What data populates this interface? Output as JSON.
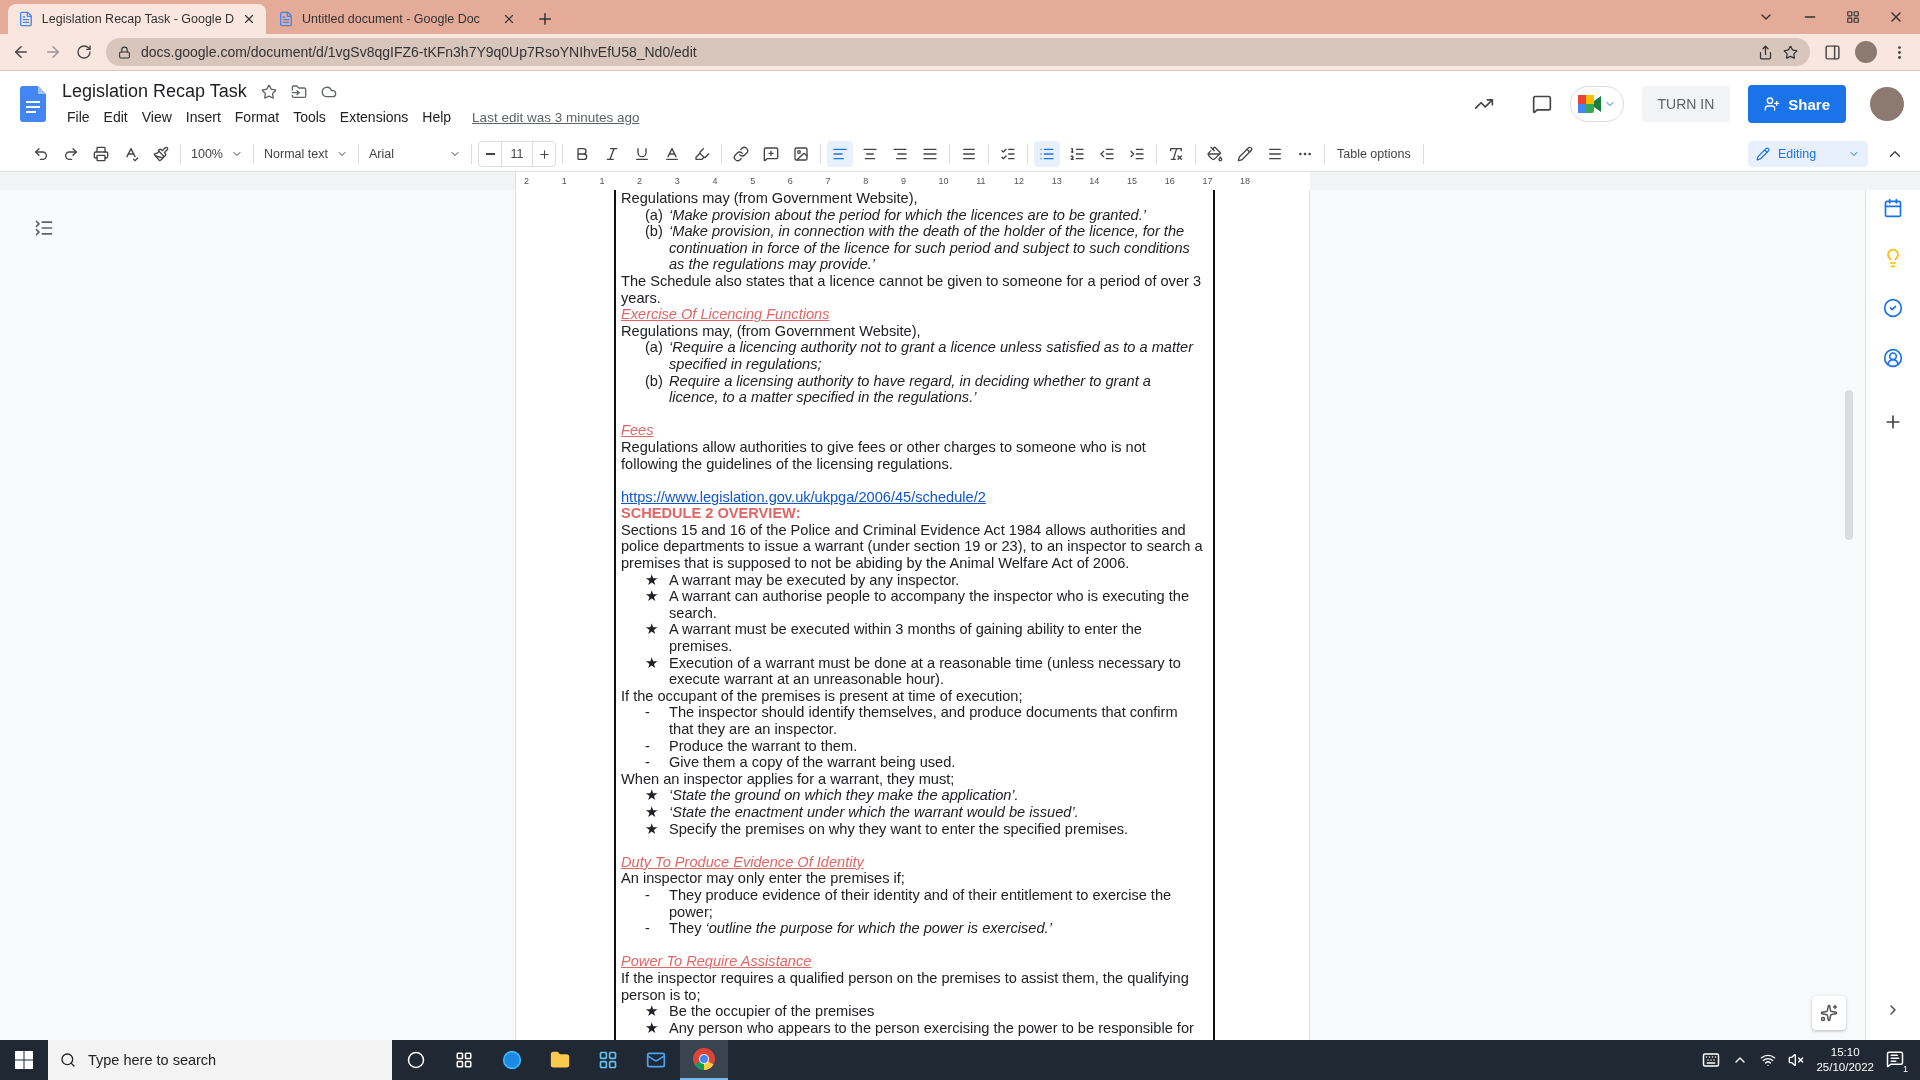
{
  "browser": {
    "tabs": [
      {
        "title": "Legislation Recap Task - Google D",
        "selected": true
      },
      {
        "title": "Untitled document - Google Doc",
        "selected": false
      }
    ],
    "url": "docs.google.com/document/d/1vgSv8qgIFZ6-tKFn3h7Y9q0Up7RsoYNIhvEfU58_Nd0/edit"
  },
  "docs_header": {
    "title": "Legislation Recap Task",
    "menu": [
      "File",
      "Edit",
      "View",
      "Insert",
      "Format",
      "Tools",
      "Extensions",
      "Help"
    ],
    "last_edit": "Last edit was 3 minutes ago",
    "turn_in": "TURN IN",
    "share": "Share"
  },
  "toolbar": {
    "groups": [
      [
        {
          "kind": "undo"
        },
        {
          "kind": "redo"
        },
        {
          "kind": "print"
        },
        {
          "kind": "spellcheck"
        },
        {
          "kind": "paint-format"
        }
      ],
      [
        {
          "kind": "zoom",
          "label": "100%"
        }
      ],
      [
        {
          "kind": "style",
          "label": "Normal text"
        }
      ],
      [
        {
          "kind": "font",
          "label": "Arial"
        }
      ],
      [
        {
          "kind": "size",
          "label": "11"
        }
      ],
      [
        {
          "kind": "bold",
          "active": false
        },
        {
          "kind": "italic",
          "active": false
        },
        {
          "kind": "underline",
          "active": false
        },
        {
          "kind": "text-color",
          "active": false
        },
        {
          "kind": "highlight",
          "active": false
        }
      ],
      [
        {
          "kind": "link",
          "active": false
        },
        {
          "kind": "comment",
          "active": false
        },
        {
          "kind": "image",
          "active": false
        }
      ],
      [
        {
          "kind": "align-left",
          "active": true
        },
        {
          "kind": "align-center",
          "active": false
        },
        {
          "kind": "align-right",
          "active": false
        },
        {
          "kind": "align-justify",
          "active": false
        }
      ],
      [
        {
          "kind": "line-spacing",
          "active": false
        }
      ],
      [
        {
          "kind": "checklist"
        }
      ],
      [
        {
          "kind": "bullets",
          "active": true
        },
        {
          "kind": "numbered",
          "active": false
        },
        {
          "kind": "indent-less",
          "active": false
        },
        {
          "kind": "indent-more",
          "active": false
        }
      ],
      [
        {
          "kind": "clear-format",
          "active": false
        }
      ],
      [
        {
          "kind": "fill",
          "active": false
        },
        {
          "kind": "border-color",
          "active": false
        },
        {
          "kind": "border-width",
          "active": false
        },
        {
          "kind": "border-dash",
          "active": false
        }
      ],
      [
        {
          "kind": "text",
          "label": "Table options"
        }
      ]
    ],
    "mode": "Editing"
  },
  "ruler": {
    "labels": [
      "2",
      "1",
      "1",
      "2",
      "3",
      "4",
      "5",
      "6",
      "7",
      "8",
      "9",
      "10",
      "11",
      "12",
      "13",
      "14",
      "15",
      "16",
      "17",
      "18"
    ]
  },
  "document": {
    "blocks": [
      {
        "kind": "para",
        "text": "Regulations may (from Government Website),"
      },
      {
        "kind": "list",
        "items": [
          {
            "marker": "(a)",
            "text": "‘Make provision about the period for which the licences are to be granted.’",
            "italic": true
          },
          {
            "marker": "(b)",
            "text": "‘Make provision, in connection with the death of the holder of the licence, for the continuation in force of the licence for such period and subject to such conditions as the regulations may provide.’",
            "italic": true
          }
        ]
      },
      {
        "kind": "para",
        "text": "The Schedule also states that a licence cannot be given to someone for a period of over 3 years."
      },
      {
        "kind": "heading",
        "text": "Exercise Of Licencing Functions"
      },
      {
        "kind": "para",
        "text": "Regulations may, (from Government Website),"
      },
      {
        "kind": "list",
        "items": [
          {
            "marker": "(a)",
            "text": "‘Require a licencing authority not to grant a licence unless satisfied as to a matter specified in regulations;",
            "italic": true
          },
          {
            "marker": "(b)",
            "text": "Require a licensing authority to have regard, in deciding whether to grant a licence, to a matter specified in the regulations.’",
            "italic": true
          }
        ]
      },
      {
        "kind": "blank"
      },
      {
        "kind": "heading",
        "text": "Fees"
      },
      {
        "kind": "para",
        "text": "Regulations allow authorities to give fees or other charges to someone who is not following the guidelines of the licensing regulations."
      },
      {
        "kind": "blank"
      },
      {
        "kind": "link",
        "text": "https://www.legislation.gov.uk/ukpga/2006/45/schedule/2"
      },
      {
        "kind": "title",
        "text": "SCHEDULE 2 OVERVIEW:"
      },
      {
        "kind": "para",
        "text": "Sections 15 and 16 of the Police and Criminal Evidence Act 1984 allows authorities and police departments to issue a warrant (under section 19 or 23), to an inspector to search a premises that is supposed to not be abiding by the Animal Welfare Act of 2006."
      },
      {
        "kind": "list",
        "items": [
          {
            "marker": "★",
            "text": "A warrant may be executed by any inspector.",
            "italic": false
          },
          {
            "marker": "★",
            "text": "A warrant can authorise people to accompany the inspector who is executing the search.",
            "italic": false
          },
          {
            "marker": "★",
            "text": "A warrant must be executed within 3 months of gaining ability to enter the premises.",
            "italic": false
          },
          {
            "marker": "★",
            "text": "Execution of a warrant must be done at a reasonable time (unless necessary to execute warrant at an unreasonable hour).",
            "italic": false
          }
        ]
      },
      {
        "kind": "para",
        "text": "If the occupant of the premises is present at time of execution;"
      },
      {
        "kind": "list",
        "items": [
          {
            "marker": "-",
            "text": "The inspector should identify themselves, and produce documents that confirm that they are an inspector.",
            "italic": false
          },
          {
            "marker": "-",
            "text": "Produce the warrant to them.",
            "italic": false
          },
          {
            "marker": "-",
            "text": "Give them a copy of the warrant being used.",
            "italic": false
          }
        ]
      },
      {
        "kind": "para",
        "text": "When an inspector applies for a warrant, they must;"
      },
      {
        "kind": "list",
        "items": [
          {
            "marker": "★",
            "text": "‘State the ground on which they make the application’.",
            "italic": true
          },
          {
            "marker": "★",
            "text": "‘State the enactment under which the warrant would be issued’.",
            "italic": true
          },
          {
            "marker": "★",
            "text": "Specify the premises on why they want to enter the specified premises.",
            "italic": false
          }
        ]
      },
      {
        "kind": "blank"
      },
      {
        "kind": "heading",
        "text": "Duty To Produce Evidence Of Identity"
      },
      {
        "kind": "para",
        "text": "An inspector may only enter the premises if;"
      },
      {
        "kind": "list",
        "items": [
          {
            "marker": "-",
            "text": "They produce evidence of their identity and of their entitlement to exercise the power;",
            "italic": false
          },
          {
            "marker": "-",
            "text": "They *‘outline the purpose for which the power is exercised.’*",
            "italic": false
          }
        ]
      },
      {
        "kind": "blank"
      },
      {
        "kind": "heading",
        "text": "Power To Require Assistance"
      },
      {
        "kind": "para",
        "text": "If the inspector requires a qualified person on the premises to assist them, the qualifying person is to;"
      },
      {
        "kind": "list",
        "items": [
          {
            "marker": "★",
            "text": "Be the occupier of the premises",
            "italic": false
          },
          {
            "marker": "★",
            "text": "Any person who appears to the person exercising the power to be responsible for",
            "italic": false
          }
        ]
      }
    ]
  },
  "taskbar": {
    "search_placeholder": "Type here to search",
    "time": "15:10",
    "date": "25/10/2022",
    "notifications": "1"
  }
}
